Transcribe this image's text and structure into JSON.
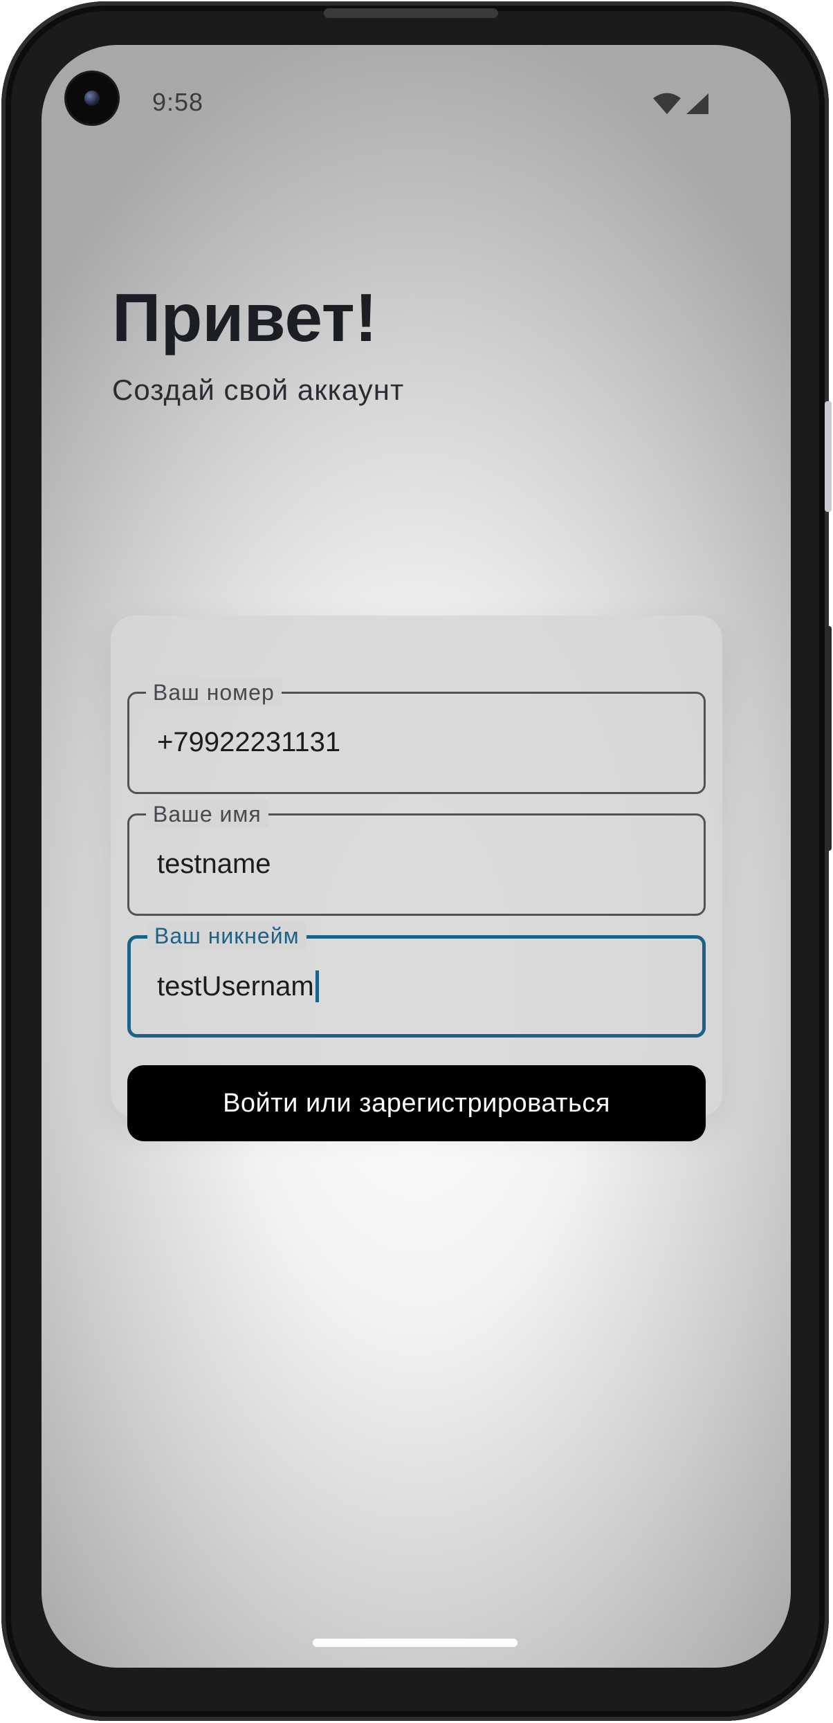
{
  "status_bar": {
    "time": "9:58",
    "icons": [
      "camera-icon",
      "wifi-icon",
      "cellular-signal-icon"
    ]
  },
  "header": {
    "title": "Привет!",
    "subtitle": "Создай свой аккаунт"
  },
  "form": {
    "phone": {
      "label": "Ваш номер",
      "value": "+79922231131"
    },
    "name": {
      "label": "Ваше имя",
      "value": "testname"
    },
    "nickname": {
      "label": "Ваш никнейм",
      "value": "testUsernam",
      "focused": true
    },
    "submit_label": "Войти или зарегистрироваться"
  },
  "colors": {
    "accent": "#1c6288",
    "button_bg": "#000000",
    "button_text": "#ffffff",
    "title_text": "#1b1f23"
  }
}
